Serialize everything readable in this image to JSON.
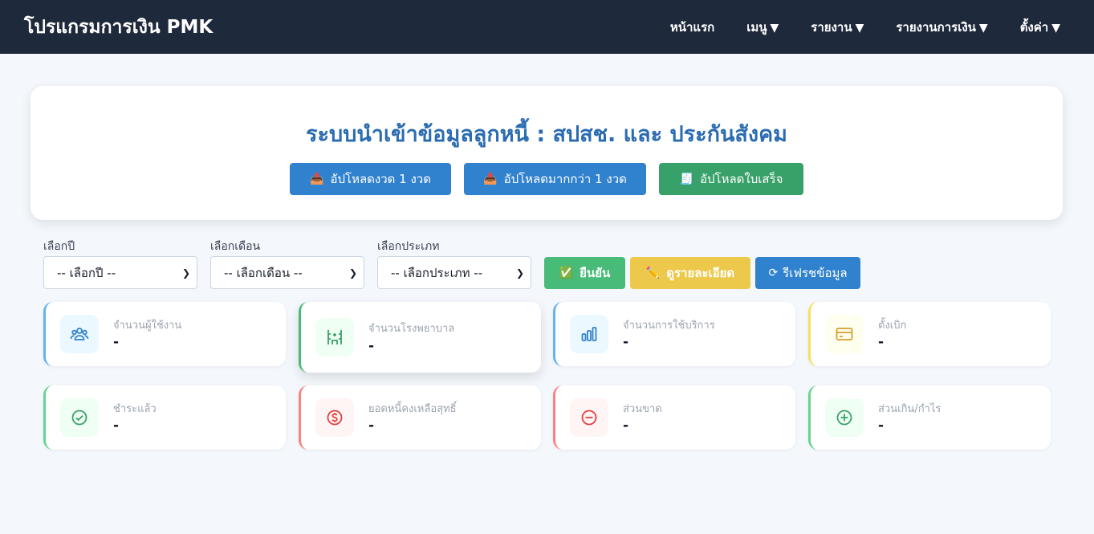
{
  "app": {
    "title": "โปรแกรมการเงิน PMK"
  },
  "nav": {
    "items": [
      {
        "label": "หน้าแรก",
        "caret": ""
      },
      {
        "label": "เมนู",
        "caret": "▼"
      },
      {
        "label": "รายงาน",
        "caret": "▼"
      },
      {
        "label": "รายงานการเงิน",
        "caret": "▼"
      },
      {
        "label": "ตั้งค่า",
        "caret": "▼"
      }
    ]
  },
  "hero": {
    "title": "ระบบนำเข้าข้อมูลลูกหนี้ : สปสช. และ ประกันสังคม",
    "buttons": [
      {
        "label": "อัปโหลดงวด 1 งวด",
        "icon": "inbox-tray-icon",
        "glyph": "📥"
      },
      {
        "label": "อัปโหลดมากกว่า 1 งวด",
        "icon": "inbox-tray-icon",
        "glyph": "📥"
      },
      {
        "label": "อัปโหลดใบเสร็จ",
        "icon": "receipt-icon",
        "glyph": "🧾"
      }
    ]
  },
  "filters": {
    "year": {
      "label": "เลือกปี",
      "value": "-- เลือกปี --"
    },
    "month": {
      "label": "เลือกเดือน",
      "value": "-- เลือกเดือน --"
    },
    "type": {
      "label": "เลือกประเภท",
      "value": "-- เลือกประเภท --"
    }
  },
  "actions": {
    "confirm": {
      "label": "ยืนยัน",
      "glyph": "✅",
      "icon": "check-box-icon"
    },
    "details": {
      "label": "ดูรายละเอียด",
      "glyph": "✏️",
      "icon": "pencil-icon"
    },
    "refresh": {
      "label": "รีเฟรชข้อมูล",
      "glyph": "⟳",
      "icon": "refresh-icon"
    }
  },
  "stats": [
    {
      "label": "จำนวนผู้ใช้งาน",
      "value": "-",
      "icon": "users-icon",
      "accent": "#63b3ed",
      "tint": "#ebf8ff",
      "iconColor": "#3182ce"
    },
    {
      "label": "จำนวนโรงพยาบาล",
      "value": "-",
      "icon": "hospital-icon",
      "accent": "#48bb78",
      "tint": "#f0fff4",
      "iconColor": "#38a169"
    },
    {
      "label": "จำนวนการใช้บริการ",
      "value": "-",
      "icon": "bar-chart-icon",
      "accent": "#63b3ed",
      "tint": "#ebf8ff",
      "iconColor": "#3182ce"
    },
    {
      "label": "ตั้งเบิก",
      "value": "-",
      "icon": "credit-card-icon",
      "accent": "#f6e05e",
      "tint": "#fffff0",
      "iconColor": "#d69e2e"
    },
    {
      "label": "ชำระแล้ว",
      "value": "-",
      "icon": "check-circle-icon",
      "accent": "#68d391",
      "tint": "#f0fff4",
      "iconColor": "#38a169"
    },
    {
      "label": "ยอดหนี้คงเหลือสุทธิ์",
      "value": "-",
      "icon": "dollar-circle-icon",
      "accent": "#fc8181",
      "tint": "#fff5f5",
      "iconColor": "#e53e3e"
    },
    {
      "label": "ส่วนขาด",
      "value": "-",
      "icon": "minus-circle-icon",
      "accent": "#fc8181",
      "tint": "#fff5f5",
      "iconColor": "#e53e3e"
    },
    {
      "label": "ส่วนเกิน/กำไร",
      "value": "-",
      "icon": "plus-circle-icon",
      "accent": "#68d391",
      "tint": "#f0fff4",
      "iconColor": "#38a169"
    }
  ]
}
